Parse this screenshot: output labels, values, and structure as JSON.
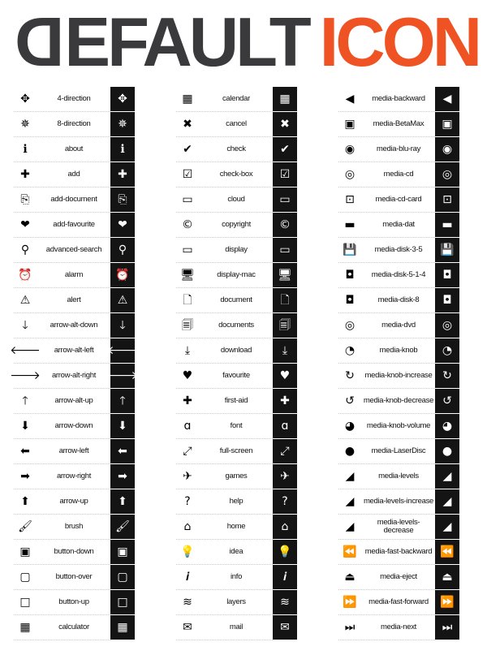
{
  "header": {
    "title_dark": "EFAULT",
    "title_dark_first": "D",
    "title_accent": "ICON",
    "colors": {
      "dark": "#3a3a3c",
      "accent": "#ef5324",
      "tile": "#141414"
    }
  },
  "columns": [
    {
      "items": [
        {
          "label": "4-direction",
          "icon": "move-4-direction-icon",
          "glyph": "✥"
        },
        {
          "label": "8-direction",
          "icon": "move-8-direction-icon",
          "glyph": "✵"
        },
        {
          "label": "about",
          "icon": "about-bubble-icon",
          "glyph": "ℹ"
        },
        {
          "label": "add",
          "icon": "add-plus-icon",
          "glyph": "✚"
        },
        {
          "label": "add-document",
          "icon": "add-document-icon",
          "glyph": "⎘"
        },
        {
          "label": "add-favourite",
          "icon": "add-favourite-icon",
          "glyph": "❤"
        },
        {
          "label": "advanced-search",
          "icon": "advanced-search-icon",
          "glyph": "⚲"
        },
        {
          "label": "alarm",
          "icon": "alarm-clock-icon",
          "glyph": "⏰"
        },
        {
          "label": "alert",
          "icon": "alert-triangle-icon",
          "glyph": "⚠"
        },
        {
          "label": "arrow-alt-down",
          "icon": "arrow-alt-down-icon",
          "glyph": "🡓"
        },
        {
          "label": "arrow-alt-left",
          "icon": "arrow-alt-left-icon",
          "glyph": "🡐"
        },
        {
          "label": "arrow-alt-right",
          "icon": "arrow-alt-right-icon",
          "glyph": "🡒"
        },
        {
          "label": "arrow-alt-up",
          "icon": "arrow-alt-up-icon",
          "glyph": "🡑"
        },
        {
          "label": "arrow-down",
          "icon": "arrow-down-icon",
          "glyph": "⬇"
        },
        {
          "label": "arrow-left",
          "icon": "arrow-left-icon",
          "glyph": "⬅"
        },
        {
          "label": "arrow-right",
          "icon": "arrow-right-icon",
          "glyph": "➡"
        },
        {
          "label": "arrow-up",
          "icon": "arrow-up-icon",
          "glyph": "⬆"
        },
        {
          "label": "brush",
          "icon": "brush-icon",
          "glyph": "🖌"
        },
        {
          "label": "button-down",
          "icon": "button-down-icon",
          "glyph": "▣"
        },
        {
          "label": "button-over",
          "icon": "button-over-icon",
          "glyph": "▢"
        },
        {
          "label": "button-up",
          "icon": "button-up-icon",
          "glyph": "□"
        },
        {
          "label": "calculator",
          "icon": "calculator-icon",
          "glyph": "▦"
        }
      ]
    },
    {
      "items": [
        {
          "label": "calendar",
          "icon": "calendar-icon",
          "glyph": "▦"
        },
        {
          "label": "cancel",
          "icon": "cancel-x-icon",
          "glyph": "✖"
        },
        {
          "label": "check",
          "icon": "check-mark-icon",
          "glyph": "✔"
        },
        {
          "label": "check-box",
          "icon": "check-box-icon",
          "glyph": "☑"
        },
        {
          "label": "cloud",
          "icon": "cloud-speech-bubble-icon",
          "glyph": "▭"
        },
        {
          "label": "copyright",
          "icon": "copyright-icon",
          "glyph": "©"
        },
        {
          "label": "display",
          "icon": "display-monitor-icon",
          "glyph": "▭"
        },
        {
          "label": "display-mac",
          "icon": "display-mac-icon",
          "glyph": "🖥"
        },
        {
          "label": "document",
          "icon": "document-icon",
          "glyph": "🗋"
        },
        {
          "label": "documents",
          "icon": "documents-icon",
          "glyph": "🗐"
        },
        {
          "label": "download",
          "icon": "download-icon",
          "glyph": "⤓"
        },
        {
          "label": "favourite",
          "icon": "favourite-heart-icon",
          "glyph": "♥"
        },
        {
          "label": "first-aid",
          "icon": "first-aid-cross-icon",
          "glyph": "✚"
        },
        {
          "label": "font",
          "icon": "font-icon",
          "glyph": "ɑ"
        },
        {
          "label": "full-screen",
          "icon": "full-screen-icon",
          "glyph": "⤢"
        },
        {
          "label": "games",
          "icon": "games-paper-plane-icon",
          "glyph": "✈"
        },
        {
          "label": "help",
          "icon": "help-question-icon",
          "glyph": "?"
        },
        {
          "label": "home",
          "icon": "home-icon",
          "glyph": "⌂"
        },
        {
          "label": "idea",
          "icon": "idea-lightbulb-icon",
          "glyph": "💡"
        },
        {
          "label": "info",
          "icon": "info-icon",
          "glyph": "𝒊"
        },
        {
          "label": "layers",
          "icon": "layers-icon",
          "glyph": "≋"
        },
        {
          "label": "mail",
          "icon": "mail-envelope-icon",
          "glyph": "✉"
        }
      ]
    },
    {
      "items": [
        {
          "label": "media-backward",
          "icon": "media-backward-icon",
          "glyph": "◀"
        },
        {
          "label": "media-BetaMax",
          "icon": "media-betamax-icon",
          "glyph": "▣"
        },
        {
          "label": "media-blu-ray",
          "icon": "media-blu-ray-icon",
          "glyph": "◉"
        },
        {
          "label": "media-cd",
          "icon": "media-cd-icon",
          "glyph": "◎"
        },
        {
          "label": "media-cd-card",
          "icon": "media-cd-card-icon",
          "glyph": "⊡"
        },
        {
          "label": "media-dat",
          "icon": "media-dat-icon",
          "glyph": "▬"
        },
        {
          "label": "media-disk-3-5",
          "icon": "media-disk-3-5-icon",
          "glyph": "💾"
        },
        {
          "label": "media-disk-5-1-4",
          "icon": "media-disk-5-1-4-icon",
          "glyph": "◘"
        },
        {
          "label": "media-disk-8",
          "icon": "media-disk-8-icon",
          "glyph": "◘"
        },
        {
          "label": "media-dvd",
          "icon": "media-dvd-icon",
          "glyph": "◎"
        },
        {
          "label": "media-knob",
          "icon": "media-knob-icon",
          "glyph": "◔"
        },
        {
          "label": "media-knob-increase",
          "icon": "media-knob-increase-icon",
          "glyph": "↻"
        },
        {
          "label": "media-knob-decrease",
          "icon": "media-knob-decrease-icon",
          "glyph": "↺"
        },
        {
          "label": "media-knob-volume",
          "icon": "media-knob-volume-icon",
          "glyph": "◕"
        },
        {
          "label": "media-LaserDisc",
          "icon": "media-laserdisc-icon",
          "glyph": "●"
        },
        {
          "label": "media-levels",
          "icon": "media-levels-icon",
          "glyph": "◢"
        },
        {
          "label": "media-levels-increase",
          "icon": "media-levels-increase-icon",
          "glyph": "◢"
        },
        {
          "label": "media-levels-decrease",
          "icon": "media-levels-decrease-icon",
          "glyph": "◢"
        },
        {
          "label": "media-fast-backward",
          "icon": "media-fast-backward-icon",
          "glyph": "⏪"
        },
        {
          "label": "media-eject",
          "icon": "media-eject-icon",
          "glyph": "⏏"
        },
        {
          "label": "media-fast-forward",
          "icon": "media-fast-forward-icon",
          "glyph": "⏩"
        },
        {
          "label": "media-next",
          "icon": "media-next-icon",
          "glyph": "⏭"
        }
      ]
    }
  ]
}
